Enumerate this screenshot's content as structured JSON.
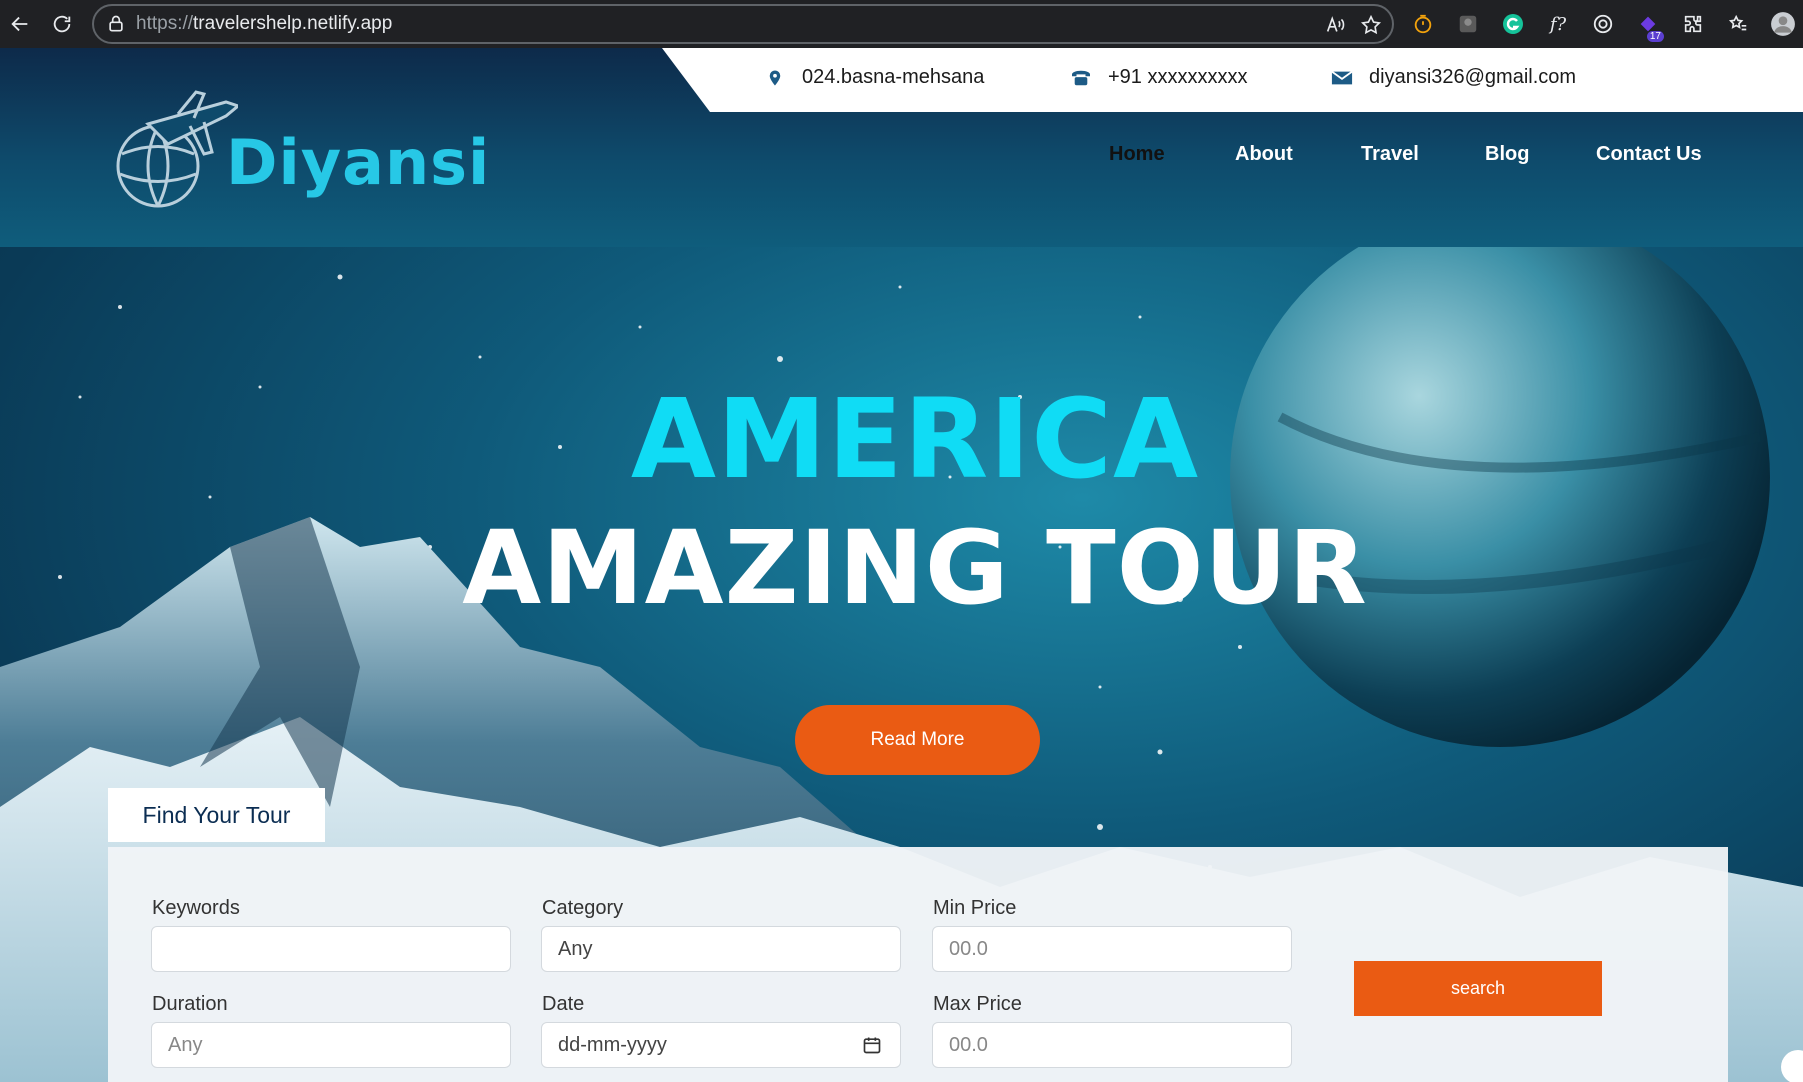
{
  "browser": {
    "url_scheme": "https://",
    "url_host": "travelershelp.netlify.app",
    "extension_badge": "17"
  },
  "topbar": {
    "address": "024.basna-mehsana",
    "phone": "+91 xxxxxxxxxx",
    "email": "diyansi326@gmail.com"
  },
  "brand": {
    "name": "Diyansi"
  },
  "nav": {
    "items": [
      {
        "label": "Home",
        "active": true
      },
      {
        "label": "About"
      },
      {
        "label": "Travel"
      },
      {
        "label": "Blog"
      },
      {
        "label": "Contact Us"
      }
    ]
  },
  "hero": {
    "line1": "AMERICA",
    "line2": "AMAZING TOUR",
    "cta": "Read More"
  },
  "finder": {
    "tab": "Find Your Tour",
    "keywords_label": "Keywords",
    "keywords_value": "",
    "category_label": "Category",
    "category_value": "Any",
    "min_price_label": "Min Price",
    "min_price_placeholder": "00.0",
    "duration_label": "Duration",
    "duration_placeholder": "Any",
    "date_label": "Date",
    "date_placeholder": "dd-mm-yyyy",
    "max_price_label": "Max Price",
    "max_price_placeholder": "00.0",
    "search_label": "search"
  },
  "colors": {
    "accent_cyan": "#10dcf5",
    "cta_orange": "#ea5b13",
    "brand_navy": "#0b2d52"
  }
}
